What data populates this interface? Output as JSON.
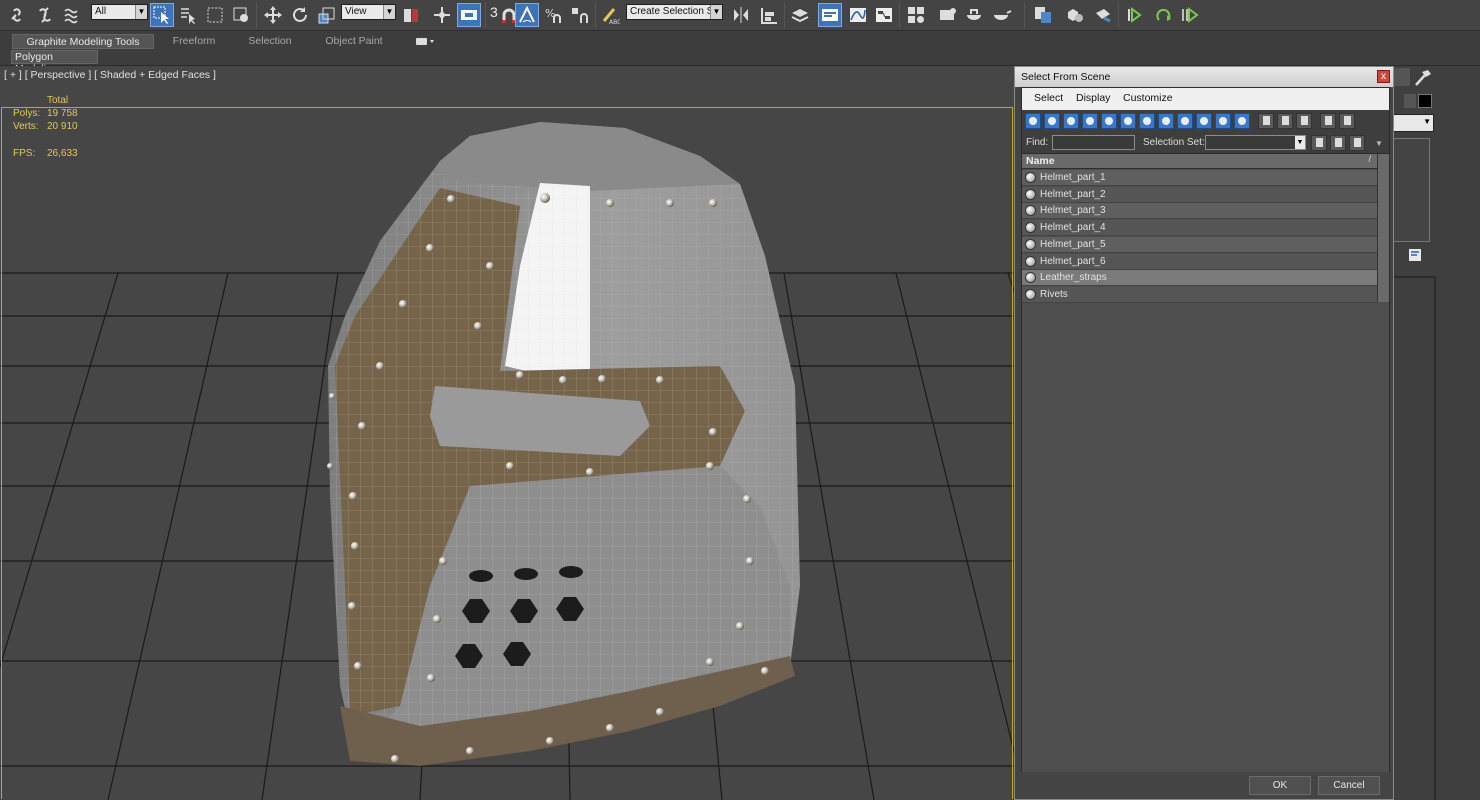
{
  "toolbar": {
    "selection_filter": "All",
    "reference_coord": "View",
    "snap_number": "3",
    "named_selection_set": "Create Selection Se"
  },
  "ribbon": {
    "tabs": [
      {
        "label": "Graphite Modeling Tools",
        "active": true
      },
      {
        "label": "Freeform",
        "active": false
      },
      {
        "label": "Selection",
        "active": false
      },
      {
        "label": "Object Paint",
        "active": false
      }
    ],
    "panel_label": "Polygon Modeling"
  },
  "viewport": {
    "label": "[ + ] [ Perspective ] [ Shaded + Edged Faces ]",
    "stats": {
      "total_label": "Total",
      "polys_label": "Polys:",
      "polys_value": "19 758",
      "verts_label": "Verts:",
      "verts_value": "20 910",
      "fps_label": "FPS:",
      "fps_value": "26,633"
    }
  },
  "dialog": {
    "title": "Select From Scene",
    "close_glyph": "x",
    "menu": [
      "Select",
      "Display",
      "Customize"
    ],
    "find_label": "Find:",
    "find_value": "",
    "selection_set_label": "Selection Set:",
    "selection_set_value": "",
    "column_name": "Name",
    "sort_glyph": "/",
    "objects": [
      {
        "name": "Helmet_part_1",
        "selected": false
      },
      {
        "name": "Helmet_part_2",
        "selected": false
      },
      {
        "name": "Helmet_part_3",
        "selected": false
      },
      {
        "name": "Helmet_part_4",
        "selected": false
      },
      {
        "name": "Helmet_part_5",
        "selected": false
      },
      {
        "name": "Helmet_part_6",
        "selected": false
      },
      {
        "name": "Leather_straps",
        "selected": true
      },
      {
        "name": "Rivets",
        "selected": false
      }
    ],
    "ok_label": "OK",
    "cancel_label": "Cancel"
  },
  "colors": {
    "accent": "#3d73b8",
    "viewport_frame": "#c9a61a",
    "stats_text": "#e8c55a",
    "row_selected": "#7a7a7a",
    "row_a": "#5f5f5f",
    "row_b": "#565656"
  }
}
